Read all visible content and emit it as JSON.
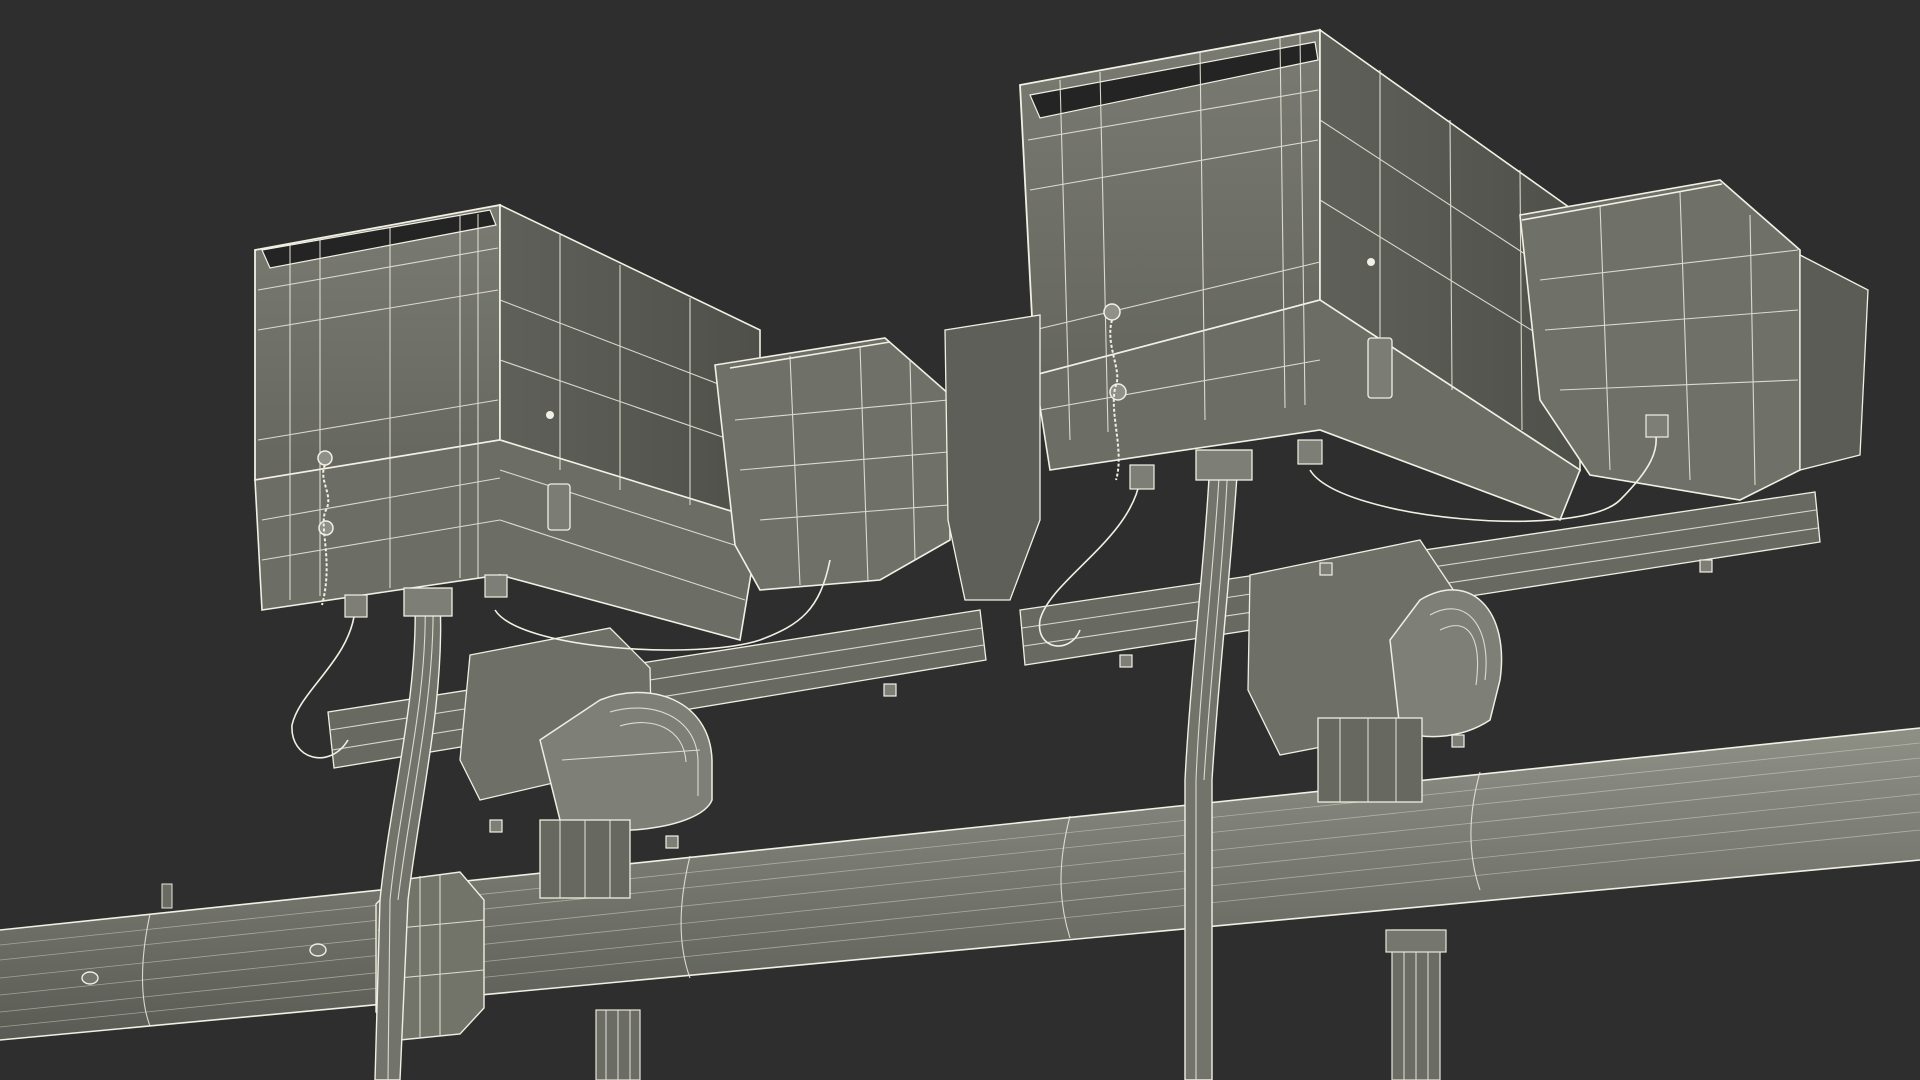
{
  "scene": {
    "background_color": "#2e2e2e",
    "model_fill_light": "#8a8b80",
    "model_fill_mid": "#6d6e66",
    "model_fill_dark": "#55564f",
    "wire_color": "#e8e6d8"
  }
}
